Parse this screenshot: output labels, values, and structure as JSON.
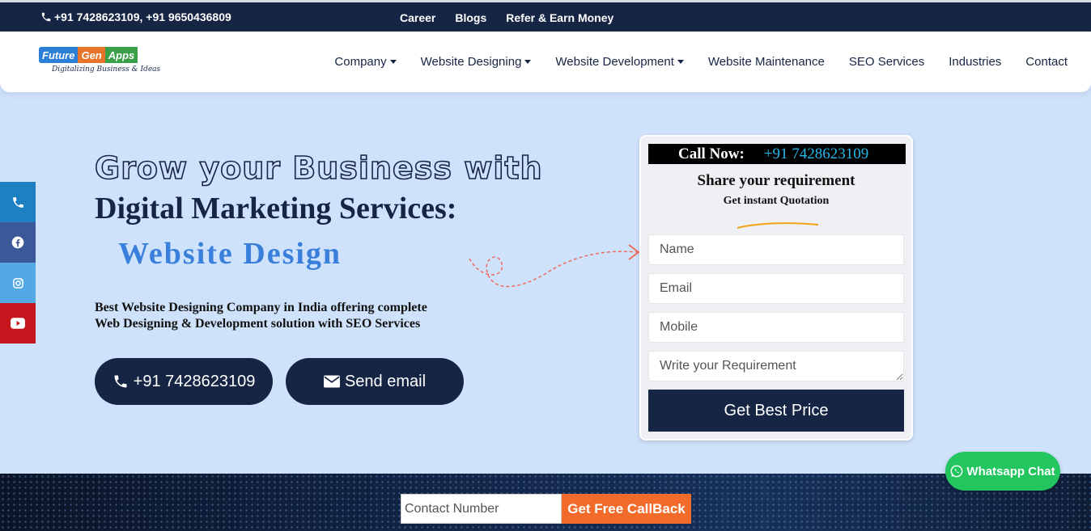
{
  "topbar": {
    "phones": "+91 7428623109, +91 9650436809",
    "links": [
      "Career",
      "Blogs",
      "Refer & Earn Money"
    ]
  },
  "logo": {
    "part1": "Future",
    "part2": "Gen",
    "part3": "Apps",
    "tagline": "Digitalizing Business & Ideas"
  },
  "nav": {
    "items": [
      {
        "label": "Company",
        "dropdown": true
      },
      {
        "label": "Website Designing",
        "dropdown": true
      },
      {
        "label": "Website Development",
        "dropdown": true
      },
      {
        "label": "Website Maintenance",
        "dropdown": false
      },
      {
        "label": "SEO Services",
        "dropdown": false
      },
      {
        "label": "Industries",
        "dropdown": false
      },
      {
        "label": "Contact",
        "dropdown": false
      }
    ]
  },
  "social": [
    {
      "icon": "phone-icon",
      "color": "#1f7fc3"
    },
    {
      "icon": "facebook-icon",
      "color": "#3b5998"
    },
    {
      "icon": "instagram-icon",
      "color": "#52a9e6"
    },
    {
      "icon": "youtube-icon",
      "color": "#c4161c"
    }
  ],
  "hero": {
    "line1": "Grow your Business with",
    "line2": "Digital Marketing Services:",
    "line3": "Website Design",
    "desc1": "Best Website Designing Company in India offering complete",
    "desc2": "Web Designing & Development solution with SEO Services",
    "call_label": "+91 7428623109",
    "email_label": "Send email"
  },
  "form": {
    "call_now": "Call Now:",
    "call_number": "+91 7428623109",
    "title": "Share your requirement",
    "subtitle": "Get instant Quotation",
    "name_placeholder": "Name",
    "email_placeholder": "Email",
    "mobile_placeholder": "Mobile",
    "req_placeholder": "Write your Requirement",
    "submit": "Get Best Price"
  },
  "callback": {
    "placeholder": "Contact Number",
    "button": "Get Free CallBack"
  },
  "whatsapp": {
    "label": "Whatsapp Chat"
  },
  "colors": {
    "navy": "#162544",
    "hero_bg": "#cfe2fb",
    "accent_blue": "#3a7fdb",
    "orange": "#f26b2a",
    "whatsapp": "#22c55e"
  }
}
